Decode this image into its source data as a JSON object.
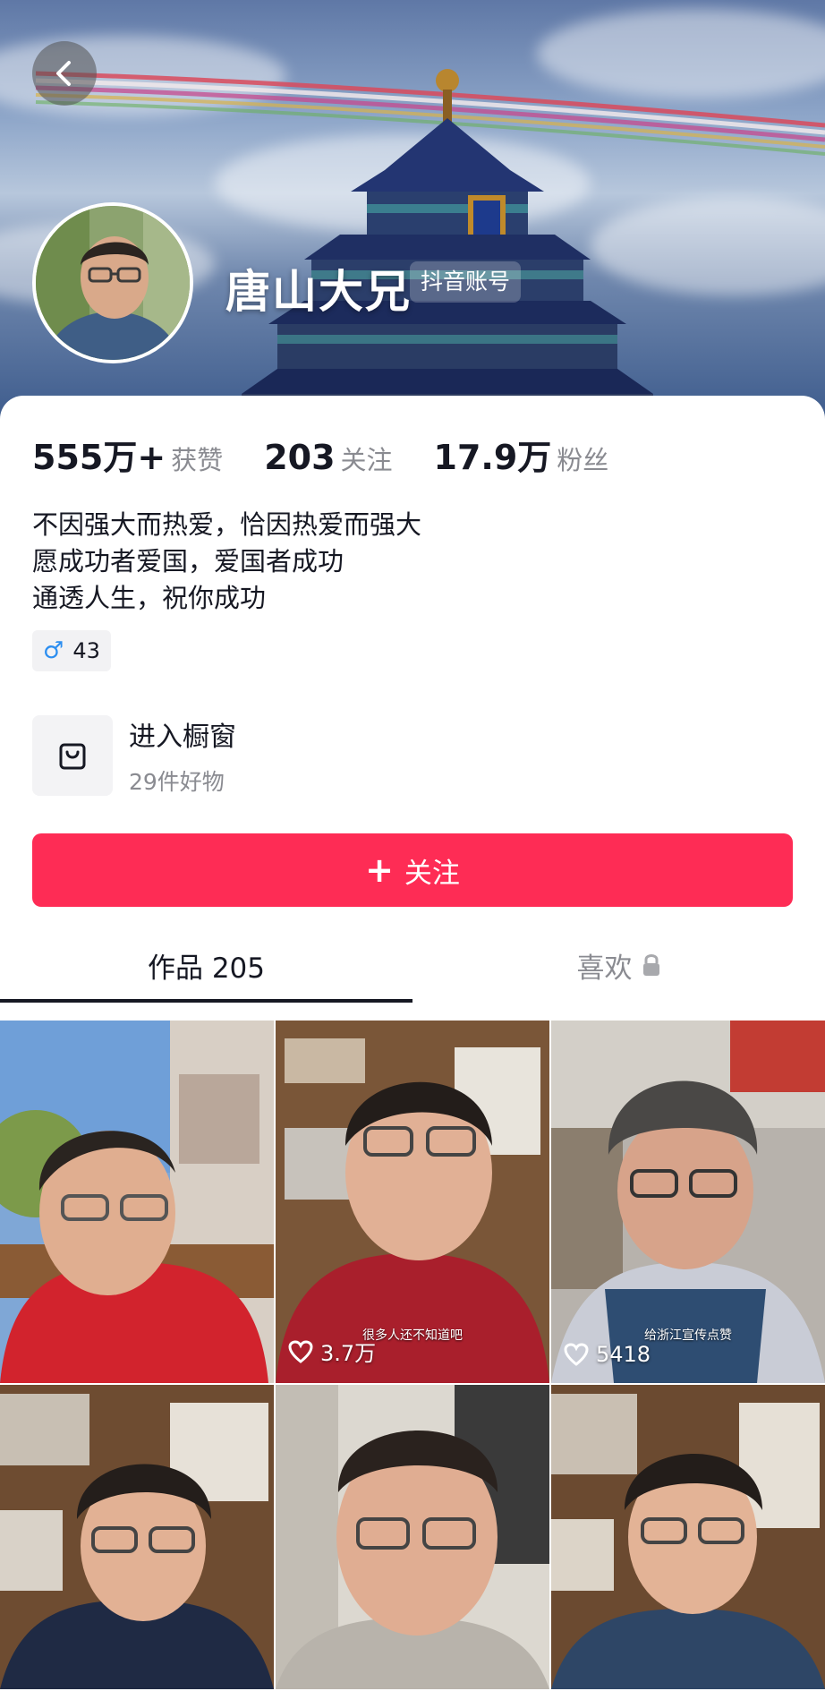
{
  "profile": {
    "nickname": "唐山大兄",
    "account_tag": "抖音账号",
    "back_icon": "chevron-left-icon"
  },
  "stats": [
    {
      "value": "555万+",
      "label": "获赞"
    },
    {
      "value": "203",
      "label": "关注"
    },
    {
      "value": "17.9万",
      "label": "粉丝"
    }
  ],
  "bio": {
    "lines": [
      "不因强大而热爱，恰因热爱而强大",
      "愿成功者爱国，爱国者成功",
      "通透人生，祝你成功"
    ]
  },
  "gender_badge": {
    "symbol": "♂",
    "age": "43",
    "symbol_color": "#2c8ef0"
  },
  "shop": {
    "title": "进入橱窗",
    "subtitle": "29件好物",
    "icon": "shopping-bag-icon"
  },
  "follow_button": {
    "plus": "+",
    "label": "关注",
    "color": "#fe2c55"
  },
  "tabs": [
    {
      "label": "作品 205",
      "active": true
    },
    {
      "label": "喜欢",
      "active": false,
      "icon": "lock-icon"
    }
  ],
  "videos": [
    {
      "likes": "",
      "caption": ""
    },
    {
      "likes": "3.7万",
      "caption": "很多人还不知道吧"
    },
    {
      "likes": "5418",
      "caption": "给浙江宣传点赞"
    },
    {
      "likes": "",
      "caption": ""
    },
    {
      "likes": "",
      "caption": ""
    },
    {
      "likes": "",
      "caption": ""
    }
  ]
}
